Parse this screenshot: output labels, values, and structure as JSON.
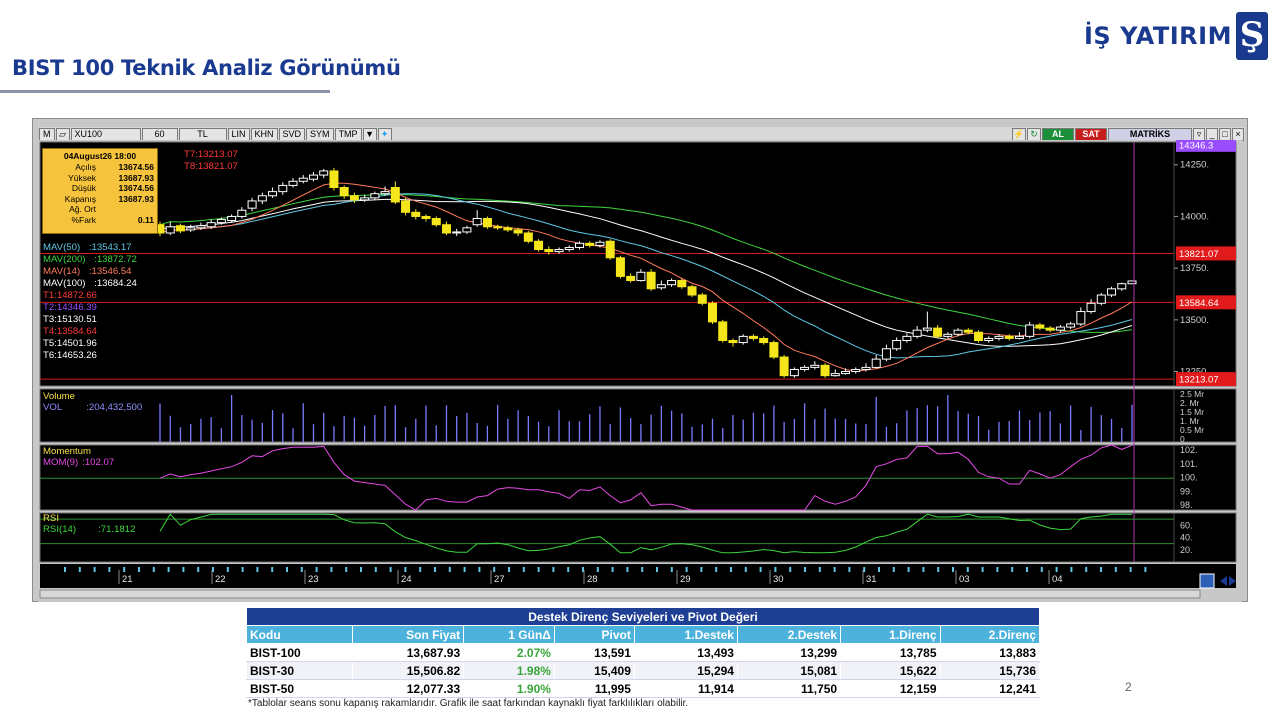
{
  "header": {
    "title": "BIST 100 Teknik Analiz Görünümü",
    "brand": "İŞ YATIRIM",
    "brand_logo_glyph": "Ş"
  },
  "toolbar": {
    "m": "M",
    "symbol": "XU100",
    "period": "60",
    "currency": "TL",
    "buttons": [
      "LIN",
      "KHN",
      "SVD",
      "SYM",
      "TMP"
    ],
    "al": "AL",
    "sat": "SAT",
    "brand": "MATRİKS",
    "icons": [
      "bolt-icon",
      "refresh-icon"
    ]
  },
  "infobox": {
    "date": "04August26 18:00",
    "rows": [
      {
        "k": "Açılış",
        "v": "13674.56"
      },
      {
        "k": "Yüksek",
        "v": "13687.93"
      },
      {
        "k": "Düşük",
        "v": "13674.56"
      },
      {
        "k": "Kapanış",
        "v": "13687.93"
      },
      {
        "k": "Ağ. Ort",
        "v": ""
      },
      {
        "k": "%Fark",
        "v": "0.11"
      }
    ]
  },
  "targets_top": [
    {
      "label": "T7:13213.07",
      "color": "#ff3b3b"
    },
    {
      "label": "T8:13821.07",
      "color": "#ff3b3b"
    }
  ],
  "legend": [
    {
      "label": "MAV(50)",
      "value": ":13543.17",
      "color": "#5ec8e6"
    },
    {
      "label": "MAV(200)",
      "value": ":13872.72",
      "color": "#3ed63e"
    },
    {
      "label": "MAV(14)",
      "value": ":13546.54",
      "color": "#ff7a5a"
    },
    {
      "label": "MAV(100)",
      "value": ":13684.24",
      "color": "#ffffff"
    },
    {
      "label": "T1:14872.66",
      "value": "",
      "color": "#ff3b3b"
    },
    {
      "label": "T2:14346.39",
      "value": "",
      "color": "#9a4dff"
    },
    {
      "label": "T3:15130.51",
      "value": "",
      "color": "#ffffff"
    },
    {
      "label": "T4:13584.64",
      "value": "",
      "color": "#ff3b3b"
    },
    {
      "label": "T5:14501.96",
      "value": "",
      "color": "#ffffff"
    },
    {
      "label": "T6:14653.26",
      "value": "",
      "color": "#ffffff"
    }
  ],
  "price_axis": {
    "ticks": [
      "14250.",
      "14000.",
      "13750.",
      "13500.",
      "13250."
    ],
    "ticks_values": [
      14250,
      14000,
      13750,
      13500,
      13250
    ],
    "tags": [
      {
        "label": "14346.3",
        "value": 14346.39,
        "color": "#9a4dff"
      },
      {
        "label": "13821.07",
        "value": 13821.07,
        "color": "#e11b1b"
      },
      {
        "label": "13584.64",
        "value": 13584.64,
        "color": "#e11b1b"
      },
      {
        "label": "13213.07",
        "value": 13213.07,
        "color": "#e11b1b"
      }
    ]
  },
  "volume_panel": {
    "title": "Volume",
    "label": "VOL",
    "value": ":204,432,500",
    "ticks": [
      "2.5 Mr",
      "2. Mr",
      "1.5 Mr",
      "1. Mr",
      "0.5 Mr",
      "0"
    ]
  },
  "momentum_panel": {
    "title": "Momentum",
    "label": "MOM(9)",
    "value": ":102.07",
    "ticks": [
      "102.",
      "101.",
      "100.",
      "99.",
      "98."
    ]
  },
  "rsi_panel": {
    "title": "RSI",
    "label": "RSI(14)",
    "value": ":71.1812",
    "ticks": [
      "60.",
      "40.",
      "20."
    ]
  },
  "x_axis": {
    "labels": [
      "21",
      "22",
      "23",
      "24",
      "27",
      "28",
      "29",
      "30",
      "31",
      "03",
      "04"
    ]
  },
  "chart_data": {
    "type": "candlestick",
    "title": "",
    "symbol": "XU100",
    "interval": "60",
    "ylim": [
      13180,
      14360
    ],
    "candles": [
      [
        13960,
        13920,
        13975,
        13905
      ],
      [
        13920,
        13950,
        13975,
        13910
      ],
      [
        13955,
        13930,
        13965,
        13920
      ],
      [
        13935,
        13945,
        13960,
        13925
      ],
      [
        13945,
        13955,
        13970,
        13935
      ],
      [
        13950,
        13970,
        13985,
        13940
      ],
      [
        13970,
        13985,
        13995,
        13960
      ],
      [
        13980,
        14000,
        14010,
        13970
      ],
      [
        14000,
        14030,
        14045,
        13990
      ],
      [
        14040,
        14075,
        14090,
        14025
      ],
      [
        14075,
        14100,
        14115,
        14060
      ],
      [
        14100,
        14120,
        14140,
        14090
      ],
      [
        14120,
        14150,
        14165,
        14105
      ],
      [
        14150,
        14170,
        14185,
        14140
      ],
      [
        14170,
        14185,
        14200,
        14160
      ],
      [
        14180,
        14200,
        14215,
        14170
      ],
      [
        14200,
        14220,
        14230,
        14185
      ],
      [
        14220,
        14140,
        14235,
        14125
      ],
      [
        14140,
        14100,
        14150,
        14085
      ],
      [
        14100,
        14080,
        14115,
        14065
      ],
      [
        14080,
        14090,
        14105,
        14070
      ],
      [
        14090,
        14110,
        14120,
        14080
      ],
      [
        14110,
        14120,
        14145,
        14100
      ],
      [
        14140,
        14070,
        14170,
        14060
      ],
      [
        14075,
        14020,
        14090,
        14005
      ],
      [
        14020,
        14000,
        14035,
        13985
      ],
      [
        14000,
        13990,
        14010,
        13975
      ],
      [
        13990,
        13960,
        14000,
        13950
      ],
      [
        13960,
        13920,
        13975,
        13910
      ],
      [
        13920,
        13925,
        13940,
        13905
      ],
      [
        13925,
        13945,
        13955,
        13915
      ],
      [
        13960,
        13990,
        14030,
        13950
      ],
      [
        13990,
        13950,
        14000,
        13940
      ],
      [
        13950,
        13945,
        13960,
        13935
      ],
      [
        13945,
        13935,
        13955,
        13925
      ],
      [
        13935,
        13920,
        13945,
        13905
      ],
      [
        13920,
        13880,
        13930,
        13870
      ],
      [
        13880,
        13840,
        13890,
        13830
      ],
      [
        13840,
        13830,
        13855,
        13815
      ],
      [
        13830,
        13840,
        13850,
        13820
      ],
      [
        13840,
        13850,
        13860,
        13830
      ],
      [
        13850,
        13870,
        13880,
        13840
      ],
      [
        13870,
        13860,
        13880,
        13850
      ],
      [
        13860,
        13875,
        13885,
        13850
      ],
      [
        13880,
        13800,
        13890,
        13790
      ],
      [
        13800,
        13710,
        13810,
        13700
      ],
      [
        13710,
        13690,
        13725,
        13680
      ],
      [
        13690,
        13730,
        13745,
        13685
      ],
      [
        13730,
        13650,
        13745,
        13640
      ],
      [
        13655,
        13670,
        13690,
        13645
      ],
      [
        13670,
        13690,
        13700,
        13660
      ],
      [
        13690,
        13660,
        13700,
        13650
      ],
      [
        13660,
        13620,
        13670,
        13610
      ],
      [
        13620,
        13580,
        13630,
        13570
      ],
      [
        13580,
        13490,
        13590,
        13480
      ],
      [
        13490,
        13400,
        13500,
        13390
      ],
      [
        13400,
        13390,
        13410,
        13370
      ],
      [
        13390,
        13420,
        13430,
        13380
      ],
      [
        13420,
        13410,
        13430,
        13400
      ],
      [
        13410,
        13390,
        13420,
        13380
      ],
      [
        13390,
        13320,
        13400,
        13310
      ],
      [
        13320,
        13230,
        13330,
        13220
      ],
      [
        13230,
        13260,
        13270,
        13220
      ],
      [
        13260,
        13270,
        13280,
        13250
      ],
      [
        13270,
        13280,
        13300,
        13260
      ],
      [
        13280,
        13230,
        13290,
        13220
      ],
      [
        13230,
        13240,
        13260,
        13225
      ],
      [
        13240,
        13250,
        13265,
        13235
      ],
      [
        13250,
        13260,
        13270,
        13240
      ],
      [
        13260,
        13270,
        13290,
        13250
      ],
      [
        13270,
        13310,
        13330,
        13265
      ],
      [
        13310,
        13360,
        13380,
        13300
      ],
      [
        13360,
        13400,
        13415,
        13350
      ],
      [
        13400,
        13420,
        13435,
        13390
      ],
      [
        13420,
        13450,
        13470,
        13410
      ],
      [
        13450,
        13460,
        13540,
        13440
      ],
      [
        13460,
        13420,
        13475,
        13410
      ],
      [
        13420,
        13430,
        13440,
        13410
      ],
      [
        13430,
        13450,
        13460,
        13420
      ],
      [
        13450,
        13440,
        13460,
        13430
      ],
      [
        13440,
        13400,
        13450,
        13390
      ],
      [
        13400,
        13410,
        13420,
        13390
      ],
      [
        13410,
        13420,
        13430,
        13400
      ],
      [
        13420,
        13410,
        13430,
        13400
      ],
      [
        13410,
        13420,
        13440,
        13405
      ],
      [
        13420,
        13475,
        13490,
        13410
      ],
      [
        13475,
        13460,
        13485,
        13450
      ],
      [
        13460,
        13450,
        13470,
        13440
      ],
      [
        13450,
        13465,
        13475,
        13440
      ],
      [
        13465,
        13480,
        13490,
        13455
      ],
      [
        13480,
        13540,
        13560,
        13470
      ],
      [
        13540,
        13580,
        13600,
        13530
      ],
      [
        13580,
        13620,
        13630,
        13570
      ],
      [
        13620,
        13650,
        13660,
        13610
      ],
      [
        13650,
        13674.56,
        13680,
        13640
      ],
      [
        13674.56,
        13687.93,
        13687.93,
        13674.56
      ]
    ],
    "series": [
      {
        "name": "MAV(50)",
        "last": 13543.17,
        "color": "#5ec8e6"
      },
      {
        "name": "MAV(200)",
        "last": 13872.72,
        "color": "#3ed63e"
      },
      {
        "name": "MAV(14)",
        "last": 13546.54,
        "color": "#ff7a5a"
      },
      {
        "name": "MAV(100)",
        "last": 13684.24,
        "color": "#ffffff"
      }
    ],
    "levels": [
      13821.07,
      13584.64,
      13213.07
    ]
  },
  "table": {
    "title": "Destek Direnç Seviyeleri ve Pivot Değeri",
    "columns": [
      "Kodu",
      "Son Fiyat",
      "1 GünΔ",
      "Pivot",
      "1.Destek",
      "2.Destek",
      "1.Direnç",
      "2.Direnç"
    ],
    "rows": [
      [
        "BIST-100",
        "13,687.93",
        "2.07%",
        "13,591",
        "13,493",
        "13,299",
        "13,785",
        "13,883"
      ],
      [
        "BIST-30",
        "15,506.82",
        "1.98%",
        "15,409",
        "15,294",
        "15,081",
        "15,622",
        "15,736"
      ],
      [
        "BIST-50",
        "12,077.33",
        "1.90%",
        "11,995",
        "11,914",
        "11,750",
        "12,159",
        "12,241"
      ]
    ]
  },
  "footnote": "*Tablolar seans sonu kapanış rakamlarıdır. Grafik ile saat farkından kaynaklı fiyat farklılıkları olabilir.",
  "page_number": "2"
}
